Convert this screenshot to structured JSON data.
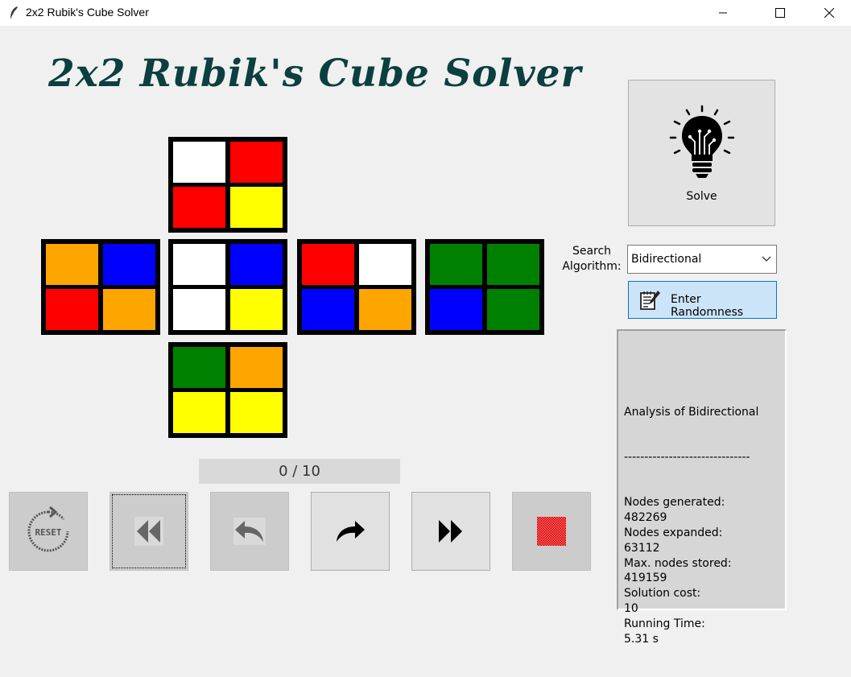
{
  "window": {
    "title": "2x2 Rubik's Cube Solver",
    "controls": [
      "minimize-icon",
      "maximize-icon",
      "close-icon"
    ]
  },
  "app": {
    "title": "2x2 Rubik's Cube Solver"
  },
  "colors": {
    "white": "#ffffff",
    "red": "#ff0000",
    "yellow": "#ffff00",
    "orange": "#ffa500",
    "blue": "#0000ff",
    "green": "#008000",
    "title": "#0c3f3f"
  },
  "cube": {
    "faces": [
      {
        "name": "up",
        "stickers": [
          "white",
          "red",
          "red",
          "yellow"
        ]
      },
      {
        "name": "left",
        "stickers": [
          "orange",
          "blue",
          "red",
          "orange"
        ]
      },
      {
        "name": "front",
        "stickers": [
          "white",
          "blue",
          "white",
          "yellow"
        ]
      },
      {
        "name": "right",
        "stickers": [
          "red",
          "white",
          "blue",
          "orange"
        ]
      },
      {
        "name": "back",
        "stickers": [
          "green",
          "green",
          "blue",
          "green"
        ]
      },
      {
        "name": "down",
        "stickers": [
          "green",
          "orange",
          "yellow",
          "yellow"
        ]
      }
    ]
  },
  "solve": {
    "label": "Solve",
    "icon": "lightbulb-icon"
  },
  "search": {
    "label": "Search\nAlgorithm:",
    "selected": "Bidirectional"
  },
  "randomness": {
    "label": "Enter Randomness",
    "icon": "notepad-pencil-icon"
  },
  "analysis": {
    "heading": "Analysis of Bidirectional",
    "separator": "-------------------------------",
    "lines": [
      "Nodes generated:",
      "482269",
      "Nodes expanded:",
      "63112",
      "Max. nodes stored:",
      "419159",
      "Solution cost:",
      "10",
      "Running Time:",
      "5.31 s"
    ]
  },
  "progress": {
    "current": 0,
    "total": 10,
    "text": "0 / 10"
  },
  "controls": [
    {
      "name": "reset-button",
      "icon": "reset-icon",
      "text": "RESET",
      "enabled": false
    },
    {
      "name": "rewind-button",
      "icon": "double-left-icon",
      "enabled": false
    },
    {
      "name": "step-back-button",
      "icon": "undo-arrow-icon",
      "enabled": false
    },
    {
      "name": "step-forward-button",
      "icon": "redo-arrow-icon",
      "enabled": true
    },
    {
      "name": "fast-forward-button",
      "icon": "double-right-icon",
      "enabled": true
    },
    {
      "name": "stop-button",
      "icon": "stop-icon",
      "enabled": false
    }
  ]
}
